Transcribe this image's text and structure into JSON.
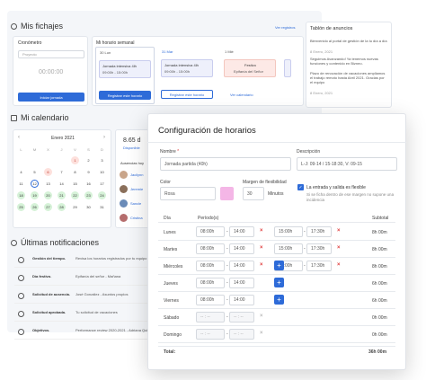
{
  "fichajes": {
    "title": "Mis fichajes",
    "cronometro": "Cronómetro",
    "proyecto_placeholder": "Proyecto",
    "timer": "00:00:00",
    "iniciar": "Iniciar jornada",
    "horario_title": "Mi horario semanal",
    "ver_registros": "Ver registros",
    "days": [
      {
        "label": "30 Lun",
        "shift": "Jornada intensiva 4lh",
        "hours": "09:00h - 15:00h"
      },
      {
        "label": "31 Mar",
        "shift": "Jornada intensiva 4lh",
        "hours": "09:00h - 15:00h"
      },
      {
        "label": "1 Mié",
        "shift": "Festivo",
        "hours": "Epifanía del Señor"
      }
    ],
    "registrar": "Registrar este horario",
    "ver_calendario": "Ver calendario",
    "tablon_title": "Tablón de anuncios",
    "tablon_items": [
      "Bienvenido al portal de gestión de la tu día a día",
      "Seguimos Avanzando! Ya tenemos nuevas funciones y contenido en Bizneo.",
      "Plazo de renovación de vacaciones ampliamos el trabajo remoto hasta Abril 2021. Gracias por el equipo"
    ],
    "tablon_dates": [
      "8 Enero, 2021",
      "8 Enero, 2021"
    ]
  },
  "calendario": {
    "title": "Mi calendario",
    "month": "Enero 2021",
    "weekdays": [
      "L",
      "M",
      "X",
      "J",
      "V",
      "S",
      "D"
    ],
    "hours": "8.65 d",
    "disponible": "Disponible",
    "ausencias": "Ausencias hoy",
    "people": [
      "Jacilynn",
      "Jeremie",
      "Sancle",
      "Cristina"
    ]
  },
  "notificaciones": {
    "title": "Últimas notificaciones",
    "items": [
      {
        "title": "Gestión del tiempo.",
        "text": "Revisa los horarios registrados por tu equipo"
      },
      {
        "title": "Día festivo.",
        "text": "Epifanía del señor - Mañana"
      },
      {
        "title": "Solicitud de ausencia.",
        "text": "José González - Asuntos propios"
      },
      {
        "title": "Solicitud aprobada.",
        "text": "Tu solicitud de vacaciones"
      },
      {
        "title": "Objetivos.",
        "text": "Performance review 2020-2021 - Adriana Quintana"
      }
    ]
  },
  "modal": {
    "title": "Configuración de horarios",
    "nombre_label": "Nombre",
    "nombre_value": "Jornada partida (40h)",
    "descripcion_label": "Descripción",
    "descripcion_value": "L-J: 09-14 / 15-18:30, V: 09-15",
    "color_label": "Color",
    "color_value": "Rosa",
    "color_hex": "#f4b6e6",
    "margen_label": "Margen de flexibilidad",
    "margen_value": "30",
    "minutos": "Minutos",
    "flex_title": "La entrada y salida es flexible",
    "flex_text": "Si se ficha dentro de ese margen no supone una incidencia",
    "col_dia": "Día",
    "col_periodos": "Período(s)",
    "col_subtotal": "Subtotal",
    "rows": [
      {
        "day": "Lunes",
        "p1a": "08:00h",
        "p1b": "14:00",
        "p2a": "15:00h",
        "p2b": "17:30h",
        "subtotal": "8h 00m"
      },
      {
        "day": "Martes",
        "p1a": "08:00h",
        "p1b": "14:00",
        "p2a": "15:00h",
        "p2b": "17:30h",
        "subtotal": "8h 00m"
      },
      {
        "day": "Miércoles",
        "p1a": "08:00h",
        "p1b": "14:00",
        "p2a": "15:00h",
        "p2b": "17:30h",
        "subtotal": "8h 00m"
      },
      {
        "day": "Jueves",
        "p1a": "08:00h",
        "p1b": "14:00",
        "subtotal": "6h 00m"
      },
      {
        "day": "Viernes",
        "p1a": "08:00h",
        "p1b": "14:00",
        "subtotal": "6h 00m"
      },
      {
        "day": "Sábado",
        "p1a": "-- : --",
        "p1b": "-- : --",
        "subtotal": "0h 00m"
      },
      {
        "day": "Domingo",
        "p1a": "-- : --",
        "p1b": "-- : --",
        "subtotal": "0h 00m"
      }
    ],
    "total_label": "Total:",
    "total_value": "36h 00m"
  }
}
